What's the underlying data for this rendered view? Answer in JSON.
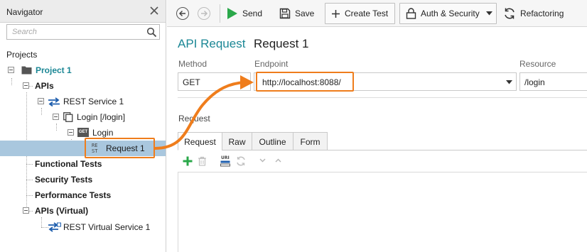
{
  "navigator": {
    "title": "Navigator",
    "search_placeholder": "Search",
    "projects_label": "Projects",
    "tree": {
      "project": "Project 1",
      "apis": "APIs",
      "rest_service": "REST Service 1",
      "resource": "Login [/login]",
      "method_node": "Login",
      "method_badge": "GET",
      "request": "Request 1",
      "request_badge_top": "RE",
      "request_badge_bottom": "ST",
      "functional_tests": "Functional Tests",
      "security_tests": "Security Tests",
      "performance_tests": "Performance Tests",
      "apis_virtual": "APIs (Virtual)",
      "rest_virtual_service": "REST Virtual Service 1"
    }
  },
  "toolbar": {
    "send": "Send",
    "save": "Save",
    "create_test": "Create Test",
    "auth_security": "Auth & Security",
    "refactoring": "Refactoring"
  },
  "editor": {
    "heading_type": "API Request",
    "heading_name": "Request 1",
    "method_label": "Method",
    "method_value": "GET",
    "endpoint_label": "Endpoint",
    "endpoint_value": "http://localhost:8088/",
    "resource_label": "Resource",
    "resource_value": "/login",
    "request_section_label": "Request",
    "tabs": [
      "Request",
      "Raw",
      "Outline",
      "Form"
    ],
    "uri_badge": "URI"
  },
  "colors": {
    "highlight": "#ef7d1c",
    "accent_teal": "#1b8795",
    "selection": "#a9c7de",
    "send_green": "#2aa84a"
  }
}
